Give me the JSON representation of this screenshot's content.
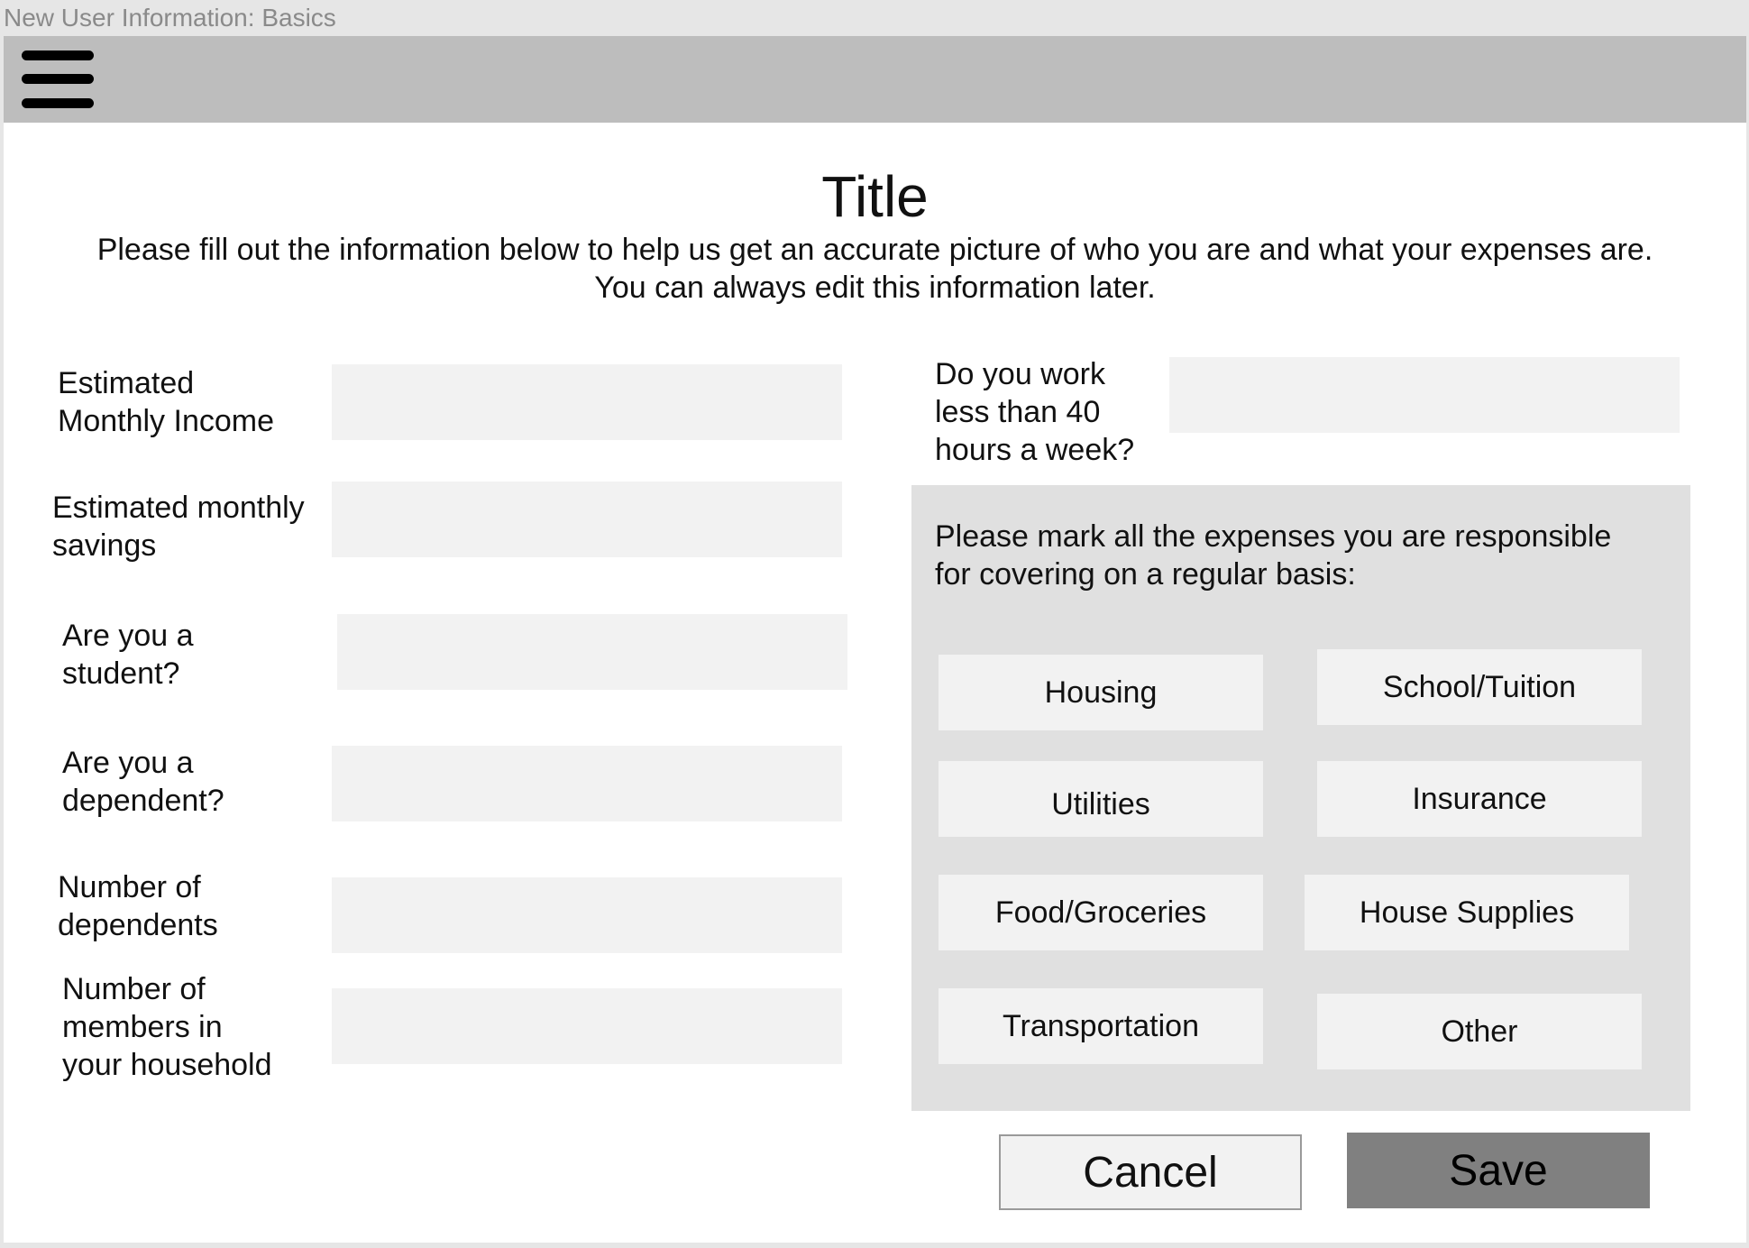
{
  "window": {
    "title": "New User Information: Basics"
  },
  "toolbar": {
    "menu_icon": "hamburger-menu-icon"
  },
  "header": {
    "title": "Title",
    "intro": "Please fill out the information below to help us get an accurate picture of who you are and what your expenses are.\nYou can always edit this information later."
  },
  "form": {
    "fields": [
      {
        "label": "Estimated\nMonthly Income",
        "value": ""
      },
      {
        "label": "Estimated monthly\nsavings",
        "value": ""
      },
      {
        "label": "Are you a\nstudent?",
        "value": ""
      },
      {
        "label": "Are you a\ndependent?",
        "value": ""
      },
      {
        "label": "Number of\ndependents",
        "value": ""
      },
      {
        "label": "Number of\nmembers in\nyour household",
        "value": ""
      }
    ],
    "work_hours": {
      "label": "Do you work\nless than 40\nhours a week?",
      "value": ""
    }
  },
  "expenses": {
    "prompt": "Please mark all the expenses you are responsible\nfor covering on a regular basis:",
    "items": [
      "Housing",
      "School/Tuition",
      "Utilities",
      "Insurance",
      "Food/Groceries",
      "House Supplies",
      "Transportation",
      "Other"
    ]
  },
  "actions": {
    "cancel": "Cancel",
    "save": "Save"
  },
  "colors": {
    "toolbar": "#bdbdbd",
    "panel": "#e0e0e0",
    "input": "#f2f2f2",
    "save_button": "#808080"
  }
}
